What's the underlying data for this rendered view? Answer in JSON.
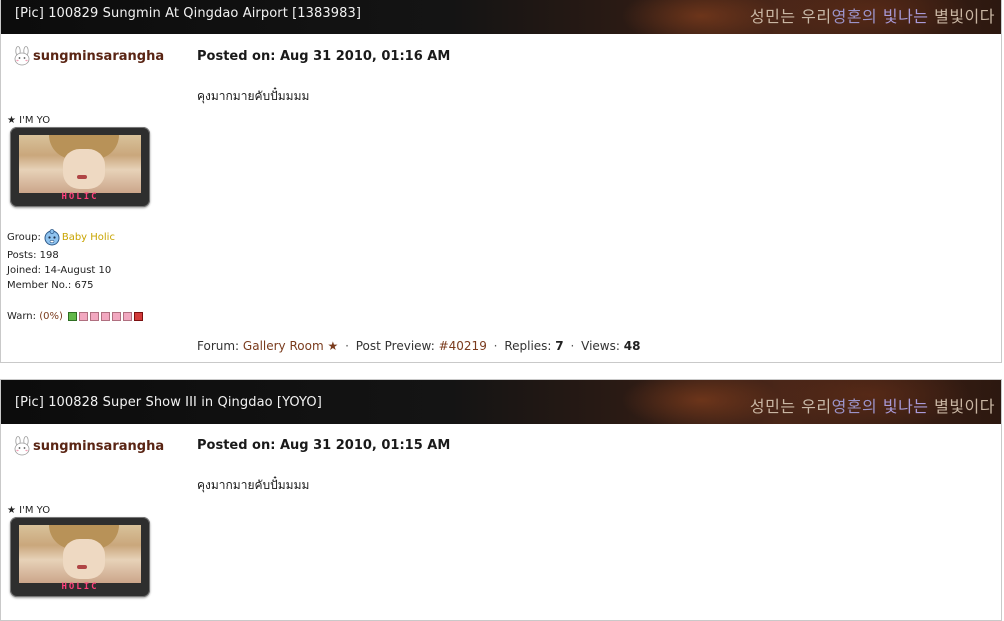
{
  "posts": [
    {
      "title": "[Pic] 100829 Sungmin At Qingdao Airport [1383983]",
      "banner_text": [
        "성민는 ",
        "우리",
        "영혼의 ",
        "빛나는 ",
        "별빛이다"
      ],
      "author": "sungminsarangha",
      "posted": "Posted on: Aug 31 2010, 01:16 AM",
      "body": "คุงมากมายคับปั๋มมมม",
      "rank": "★ I'M YO",
      "avatar_text": "HOLIC",
      "group_label": "Group:",
      "group_name": "Baby Holic",
      "posts_line": "Posts: 198",
      "joined_line": "Joined: 14-August 10",
      "member_line": "Member No.: 675",
      "warn_label": "Warn:",
      "warn_value": "(0%)",
      "footer": {
        "forum_label": "Forum:",
        "forum_link": "Gallery Room",
        "forum_star": "★",
        "preview_label": "Post Preview:",
        "preview_link": "#40219",
        "replies_label": "Replies:",
        "replies": "7",
        "views_label": "Views:",
        "views": "48"
      }
    },
    {
      "title": "[Pic] 100828 Super Show III in Qingdao [YOYO]",
      "banner_text": [
        "성민는 ",
        "우리",
        "영혼의 ",
        "빛나는 ",
        "별빛이다"
      ],
      "author": "sungminsarangha",
      "posted": "Posted on: Aug 31 2010, 01:15 AM",
      "body": "คุงมากมายคับปั๋มมมม",
      "rank": "★ I'M YO",
      "avatar_text": "HOLIC"
    }
  ],
  "colors": {
    "author": "#5a2514",
    "link": "#7a3b1d",
    "group": "#c8a400",
    "warn_ok": "#62b84a",
    "warn_bad": "#d23a3a",
    "warn_empty": "#f2a8c0"
  },
  "icons": {
    "author_icon": "bunny-icon",
    "group_icon": "baby-face-icon"
  }
}
